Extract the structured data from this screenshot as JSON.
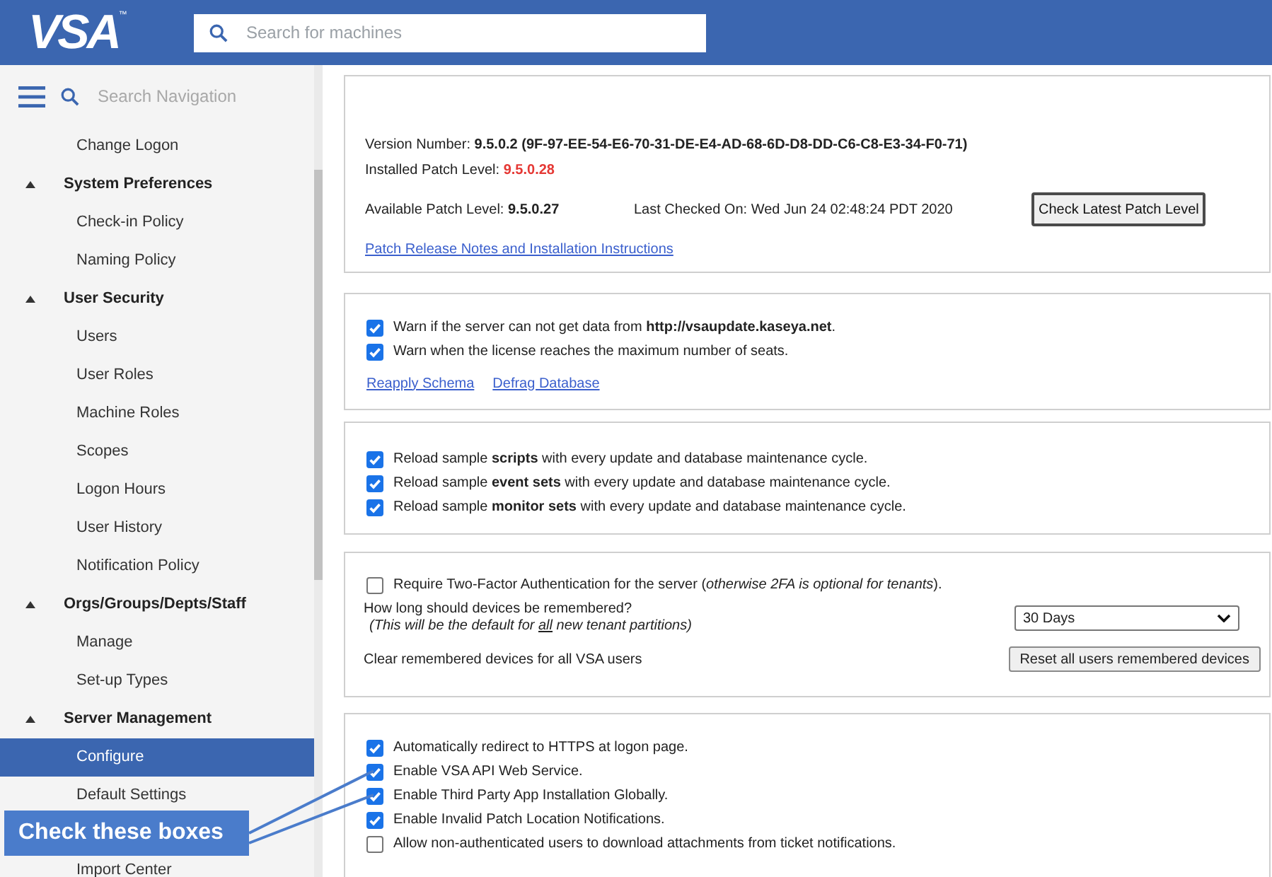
{
  "header": {
    "logo": "VSA",
    "logo_mark": "™",
    "search_placeholder": "Search for machines"
  },
  "navigation": {
    "search_placeholder": "Search Navigation",
    "items": [
      {
        "label": "Change Logon",
        "selected": false
      },
      {
        "label": "System Preferences",
        "expanded": true,
        "children": [
          {
            "label": "Check-in Policy",
            "selected": false
          },
          {
            "label": "Naming Policy",
            "selected": false
          }
        ]
      },
      {
        "label": "User Security",
        "expanded": true,
        "children": [
          {
            "label": "Users",
            "selected": false
          },
          {
            "label": "User Roles",
            "selected": false
          },
          {
            "label": "Machine Roles",
            "selected": false
          },
          {
            "label": "Scopes",
            "selected": false
          },
          {
            "label": "Logon Hours",
            "selected": false
          },
          {
            "label": "User History",
            "selected": false
          },
          {
            "label": "Notification Policy",
            "selected": false
          }
        ]
      },
      {
        "label": "Orgs/Groups/Depts/Staff",
        "expanded": true,
        "children": [
          {
            "label": "Manage",
            "selected": false
          },
          {
            "label": "Set-up Types",
            "selected": false
          }
        ]
      },
      {
        "label": "Server Management",
        "expanded": true,
        "children": [
          {
            "label": "Configure",
            "selected": true
          },
          {
            "label": "Default Settings",
            "selected": false
          },
          {
            "label": "Import Center",
            "selected": false
          }
        ]
      }
    ]
  },
  "patch_info": {
    "version_label": "Version Number:",
    "version_value": "9.5.0.2 (9F-97-EE-54-E6-70-31-DE-E4-AD-68-6D-D8-DD-C6-C8-E3-34-F0-71)",
    "installed_label": "Installed Patch Level:",
    "installed_value": "9.5.0.28",
    "available_label": "Available Patch Level:",
    "available_value": "9.5.0.27",
    "last_checked": "Last Checked On: Wed Jun 24 02:48:24 PDT 2020",
    "check_button": "Check Latest Patch Level",
    "notes_link": "Patch Release Notes and Installation Instructions"
  },
  "warnings": {
    "options": [
      {
        "label": "Warn if the server can not get data from **http://vsaupdate.kaseya.net**.",
        "checked": true
      },
      {
        "label": "Warn when the license reaches the maximum number of seats.",
        "checked": true
      }
    ],
    "links": [
      "Reapply Schema",
      "Defrag Database"
    ]
  },
  "samples": {
    "options": [
      {
        "label": "Reload sample **scripts** with every update and database maintenance cycle.",
        "checked": true
      },
      {
        "label": "Reload sample **event sets** with every update and database maintenance cycle.",
        "checked": true
      },
      {
        "label": "Reload sample **monitor sets** with every update and database maintenance cycle.",
        "checked": true
      }
    ]
  },
  "two_factor": {
    "require": {
      "label": "Require Two-Factor Authentication for the server (*otherwise 2FA is optional for tenants*).",
      "checked": false
    },
    "remember_label": "How long should devices be remembered?",
    "remember_note": {
      "before": "(This will be the default for ",
      "underlined": "all",
      "after": " new tenant partitions)"
    },
    "remember_select": "30 Days",
    "clear_label": "Clear remembered devices for all VSA users",
    "reset_button": "Reset all users remembered devices"
  },
  "security": {
    "options": [
      {
        "label": "Automatically redirect to HTTPS at logon page.",
        "checked": true
      },
      {
        "label": "Enable VSA API Web Service.",
        "checked": true
      },
      {
        "label": "Enable Third Party App Installation Globally.",
        "checked": true
      },
      {
        "label": "Enable Invalid Patch Location Notifications.",
        "checked": true
      },
      {
        "label": "Allow non-authenticated users to download attachments from ticket notifications.",
        "checked": false
      }
    ]
  },
  "callout": {
    "text": "Check these boxes"
  }
}
